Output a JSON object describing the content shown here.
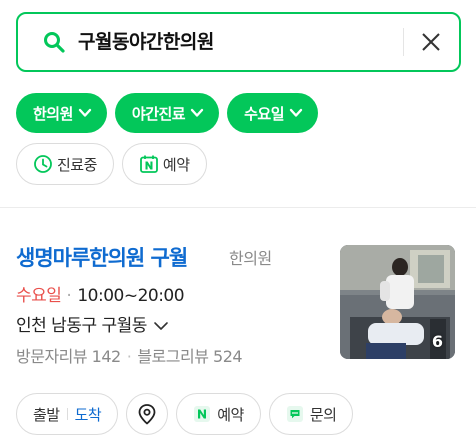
{
  "search": {
    "query": "구월동야간한의원"
  },
  "filters": {
    "primary": [
      {
        "label": "한의원"
      },
      {
        "label": "야간진료"
      },
      {
        "label": "수요일"
      }
    ],
    "secondary": [
      {
        "label": "진료중",
        "icon": "clock-icon"
      },
      {
        "label": "예약",
        "icon": "naver-booking-icon"
      }
    ]
  },
  "place": {
    "name": "생명마루한의원 구월",
    "category": "한의원",
    "hours_day": "수요일",
    "hours_time": "10:00~20:00",
    "address": "인천 남동구 구월동",
    "visitor_reviews": "방문자리뷰 142",
    "blog_reviews": "블로그리뷰 524",
    "photo_count": "6"
  },
  "actions": {
    "depart": "출발",
    "arrive": "도착",
    "reserve": "예약",
    "inquiry": "문의"
  },
  "colors": {
    "brand_green": "#03c75a",
    "link_blue": "#0f6bd0",
    "closed_red": "#e9504c"
  }
}
